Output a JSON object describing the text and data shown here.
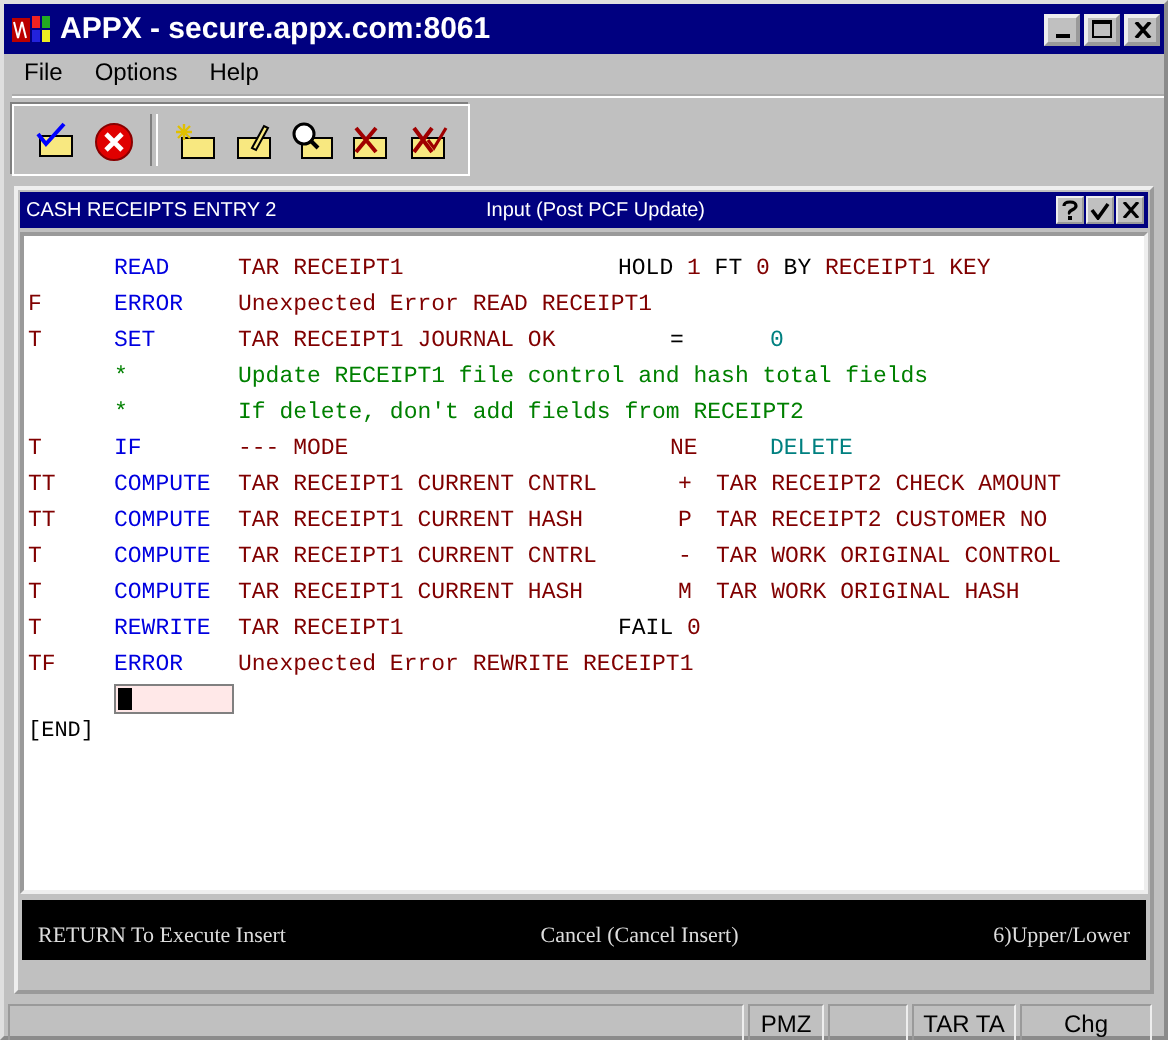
{
  "window": {
    "title": "APPX - secure.appx.com:8061"
  },
  "menu": [
    "File",
    "Options",
    "Help"
  ],
  "toolbar": [
    {
      "kind": "confirm"
    },
    {
      "kind": "cancel"
    },
    {
      "kind": "add"
    },
    {
      "kind": "change"
    },
    {
      "kind": "inquire"
    },
    {
      "kind": "delete"
    },
    {
      "kind": "delete-confirm"
    }
  ],
  "subwindow": {
    "title": "CASH RECEIPTS ENTRY 2",
    "mode": "Input  (Post PCF Update)"
  },
  "code": [
    {
      "verb": "READ",
      "kind": "statement",
      "target": "TAR RECEIPT1",
      "clause": [
        {
          "text": "HOLD",
          "kind": "keyword"
        },
        {
          "text": "1",
          "kind": "field"
        },
        {
          "text": "FT",
          "kind": "keyword"
        },
        {
          "text": "0",
          "kind": "field"
        },
        {
          "text": "BY",
          "kind": "keyword"
        },
        {
          "text": "RECEIPT1 KEY",
          "kind": "field"
        }
      ]
    },
    {
      "condition": "F",
      "verb": "ERROR",
      "kind": "statement",
      "target": "Unexpected Error READ RECEIPT1"
    },
    {
      "condition": "T",
      "verb": "SET",
      "kind": "compare",
      "target": "TAR RECEIPT1 JOURNAL OK",
      "operator": {
        "text": "=",
        "kind": "keyword"
      },
      "operand": {
        "text": "0",
        "kind": "value"
      }
    },
    {
      "verb": "*",
      "kind": "comment",
      "target": "Update RECEIPT1 file control and hash total fields"
    },
    {
      "verb": "*",
      "kind": "comment",
      "target": "If delete, don't add fields from RECEIPT2"
    },
    {
      "condition": "T",
      "verb": "IF",
      "kind": "compare",
      "target": "--- MODE",
      "operator": {
        "text": "NE",
        "kind": "field"
      },
      "operand": {
        "text": "DELETE",
        "kind": "value"
      }
    },
    {
      "condition": "TT",
      "verb": "COMPUTE",
      "kind": "compute",
      "target": "TAR RECEIPT1 CURRENT CNTRL",
      "operator": {
        "text": "+",
        "kind": "field"
      },
      "operand": {
        "text": "TAR RECEIPT2 CHECK AMOUNT",
        "kind": "field"
      }
    },
    {
      "condition": "TT",
      "verb": "COMPUTE",
      "kind": "compute",
      "target": "TAR RECEIPT1 CURRENT HASH",
      "operator": {
        "text": "P",
        "kind": "field"
      },
      "operand": {
        "text": "TAR RECEIPT2 CUSTOMER NO",
        "kind": "field"
      }
    },
    {
      "condition": "T",
      "verb": "COMPUTE",
      "kind": "compute",
      "target": "TAR RECEIPT1 CURRENT CNTRL",
      "operator": {
        "text": "-",
        "kind": "field"
      },
      "operand": {
        "text": "TAR WORK ORIGINAL CONTROL",
        "kind": "field"
      }
    },
    {
      "condition": "T",
      "verb": "COMPUTE",
      "kind": "compute",
      "target": "TAR RECEIPT1 CURRENT HASH",
      "operator": {
        "text": "M",
        "kind": "field"
      },
      "operand": {
        "text": "TAR WORK ORIGINAL HASH",
        "kind": "field"
      }
    },
    {
      "condition": "T",
      "verb": "REWRITE",
      "kind": "statement",
      "target": "TAR RECEIPT1",
      "clause": [
        {
          "text": "FAIL",
          "kind": "keyword"
        },
        {
          "text": "0",
          "kind": "field"
        }
      ]
    },
    {
      "condition": "TF",
      "verb": "ERROR",
      "kind": "statement",
      "target": "Unexpected Error REWRITE RECEIPT1"
    }
  ],
  "end_marker": "[END]",
  "prompt": [
    "RETURN To Execute Insert",
    "Cancel (Cancel Insert)",
    "6)Upper/Lower"
  ],
  "status_bar": [
    "PMZ",
    "TAR TA",
    "Chg"
  ]
}
